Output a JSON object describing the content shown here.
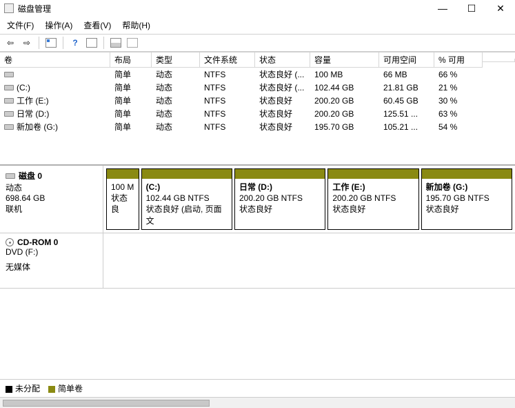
{
  "window": {
    "title": "磁盘管理"
  },
  "menu": {
    "file": "文件(F)",
    "action": "操作(A)",
    "view": "查看(V)",
    "help": "帮助(H)"
  },
  "columns": {
    "volume": "卷",
    "layout": "布局",
    "type": "类型",
    "fs": "文件系统",
    "status": "状态",
    "capacity": "容量",
    "free": "可用空间",
    "pct": "% 可用"
  },
  "volumes": [
    {
      "name": "",
      "layout": "简单",
      "type": "动态",
      "fs": "NTFS",
      "status": "状态良好 (...",
      "capacity": "100 MB",
      "free": "66 MB",
      "pct": "66 %"
    },
    {
      "name": "(C:)",
      "layout": "简单",
      "type": "动态",
      "fs": "NTFS",
      "status": "状态良好 (...",
      "capacity": "102.44 GB",
      "free": "21.81 GB",
      "pct": "21 %"
    },
    {
      "name": "工作 (E:)",
      "layout": "简单",
      "type": "动态",
      "fs": "NTFS",
      "status": "状态良好",
      "capacity": "200.20 GB",
      "free": "60.45 GB",
      "pct": "30 %"
    },
    {
      "name": "日常 (D:)",
      "layout": "简单",
      "type": "动态",
      "fs": "NTFS",
      "status": "状态良好",
      "capacity": "200.20 GB",
      "free": "125.51 ...",
      "pct": "63 %"
    },
    {
      "name": "新加卷 (G:)",
      "layout": "简单",
      "type": "动态",
      "fs": "NTFS",
      "status": "状态良好",
      "capacity": "195.70 GB",
      "free": "105.21 ...",
      "pct": "54 %"
    }
  ],
  "disk0": {
    "label": "磁盘 0",
    "dyn": "动态",
    "size": "698.64 GB",
    "online": "联机",
    "parts": [
      {
        "title": "",
        "line1": "100 M",
        "line2": "状态良",
        "flex": 0.35
      },
      {
        "title": "(C:)",
        "line1": "102.44 GB NTFS",
        "line2": "状态良好 (启动, 页面文",
        "flex": 1.0
      },
      {
        "title": "日常  (D:)",
        "line1": "200.20 GB NTFS",
        "line2": "状态良好",
        "flex": 1.0
      },
      {
        "title": "工作  (E:)",
        "line1": "200.20 GB NTFS",
        "line2": "状态良好",
        "flex": 1.0
      },
      {
        "title": "新加卷  (G:)",
        "line1": "195.70 GB NTFS",
        "line2": "状态良好",
        "flex": 1.0
      }
    ]
  },
  "cdrom": {
    "label": "CD-ROM 0",
    "line1": "DVD (F:)",
    "line2": "无媒体"
  },
  "legend": {
    "unalloc": "未分配",
    "simple": "简单卷"
  }
}
